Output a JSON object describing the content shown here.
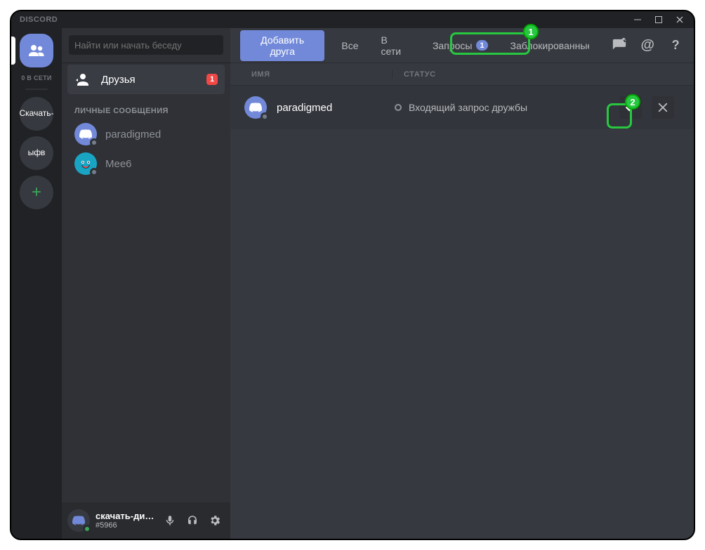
{
  "titlebar": {
    "app_name": "DISCORD"
  },
  "servers": {
    "online_label": "0 В СЕТИ",
    "items": [
      {
        "label": "Скачать-"
      },
      {
        "label": "ыфв"
      }
    ]
  },
  "dm": {
    "search_placeholder": "Найти или начать беседу",
    "friends_label": "Друзья",
    "friends_badge": "1",
    "section_header": "ЛИЧНЫЕ СООБЩЕНИЯ",
    "items": [
      {
        "name": "paradigmed"
      },
      {
        "name": "Mee6"
      }
    ]
  },
  "user_panel": {
    "name": "скачать-дис...",
    "tag": "#5966"
  },
  "topbar": {
    "add_friend": "Добавить друга",
    "tab_all": "Все",
    "tab_online": "В сети",
    "tab_pending": "Запросы",
    "tab_pending_badge": "1",
    "tab_blocked": "Заблокированные"
  },
  "columns": {
    "name": "ИМЯ",
    "status": "СТАТУС"
  },
  "requests": [
    {
      "name": "paradigmed",
      "status_text": "Входящий запрос дружбы"
    }
  ],
  "annotations": {
    "n1": "1",
    "n2": "2"
  }
}
